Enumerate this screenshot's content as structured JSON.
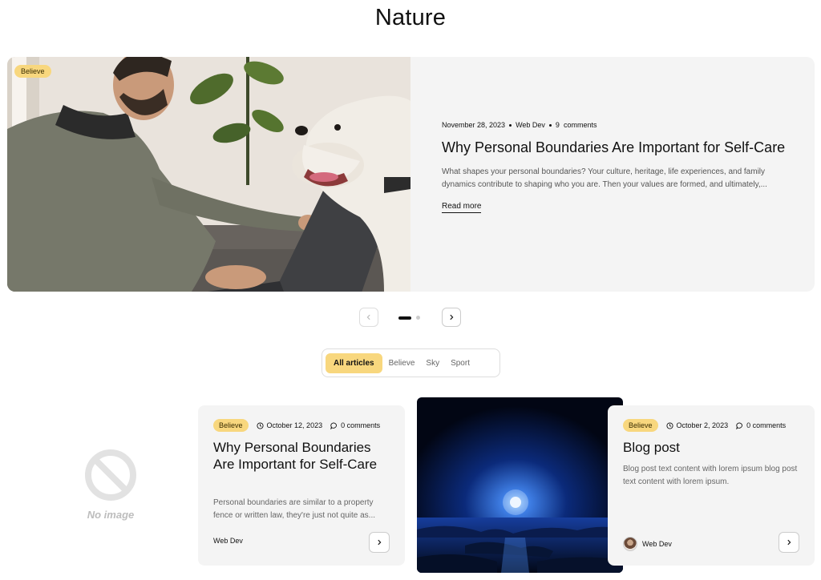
{
  "page": {
    "title": "Nature"
  },
  "hero": {
    "badge": "Believe",
    "date": "November 28, 2023",
    "author": "Web Dev",
    "comments_count": "9",
    "comments_label": "comments",
    "title": "Why Personal Boundaries Are Important for Self-Care",
    "excerpt": "What shapes your personal boundaries? Your culture, heritage, life experiences, and family dynamics contribute to shaping who you are. Then your values are formed, and ultimately,...",
    "read_more": "Read more",
    "image_icon": "man-with-dog-photo"
  },
  "pagination": {
    "current": 1,
    "total": 2
  },
  "filter": {
    "tabs": [
      {
        "label": "All articles",
        "active": true
      },
      {
        "label": "Believe",
        "active": false
      },
      {
        "label": "Sky",
        "active": false
      },
      {
        "label": "Sport",
        "active": false
      }
    ]
  },
  "noimage": {
    "label": "No image",
    "icon": "no-image-icon"
  },
  "cards": [
    {
      "badge": "Believe",
      "date": "October 12, 2023",
      "comments": "0 comments",
      "title": "Why Personal Boundaries Are Important for Self-Care",
      "excerpt": "Personal boundaries are similar to a property fence or written law, they're just not quite as...",
      "author": "Web Dev"
    },
    {
      "badge": "Believe",
      "date": "October 2, 2023",
      "comments": "0 comments",
      "title": "Blog post",
      "excerpt": "Blog post text content with lorem ipsum blog post text content with lorem ipsum.",
      "author": "Web Dev"
    }
  ],
  "colors": {
    "accent": "#f8d77e",
    "card_bg": "#f4f4f4",
    "text": "#111111"
  }
}
